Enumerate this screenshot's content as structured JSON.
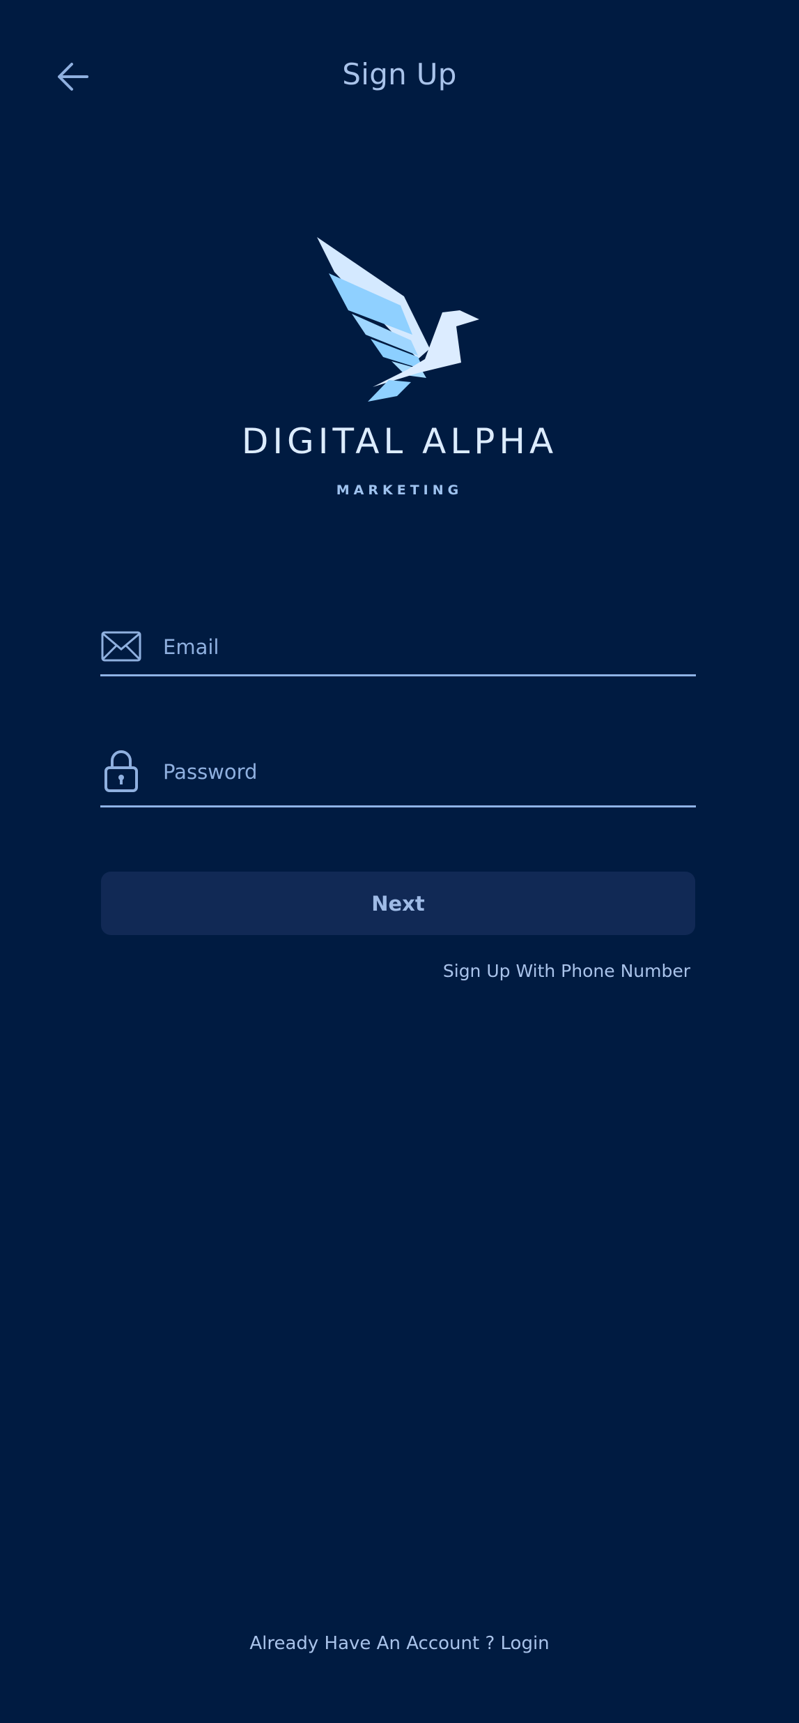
{
  "header": {
    "title": "Sign Up",
    "back_icon": "arrow-left-icon"
  },
  "brand": {
    "name": "DIGITAL ALPHA",
    "subtitle": "MARKETING",
    "logo_icon": "bird-logo-icon",
    "colors": {
      "light": "#dcecff",
      "mid": "#9fd0ff",
      "accent": "#7fc0ff"
    }
  },
  "form": {
    "email": {
      "placeholder": "Email",
      "value": "",
      "icon": "envelope-icon"
    },
    "password": {
      "placeholder": "Password",
      "value": "",
      "icon": "lock-icon"
    },
    "next_label": "Next",
    "phone_link": "Sign Up With Phone Number"
  },
  "footer": {
    "login_text": "Already Have An Account ? Login"
  },
  "theme": {
    "background": "#001b41",
    "button_bg": "#112955",
    "text": "#a9c3ea",
    "divider": "#8fb3e6"
  }
}
